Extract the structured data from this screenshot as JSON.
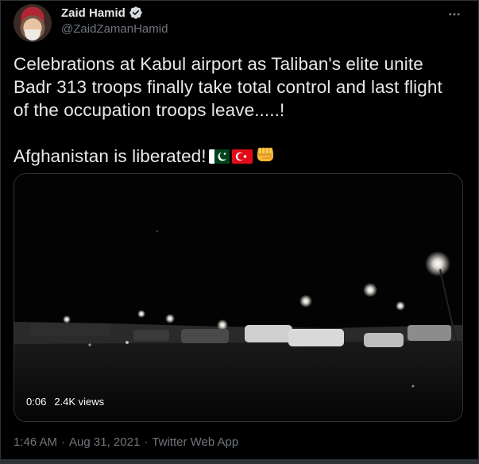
{
  "author": {
    "display_name": "Zaid Hamid",
    "handle": "@ZaidZamanHamid",
    "avatar_icon": "profile-avatar",
    "verified_icon": "verified-badge-icon"
  },
  "tweet": {
    "lines": [
      "Celebrations at Kabul airport as Taliban's elite unite",
      "Badr 313 troops finally take total control and last flight",
      "of the occupation troops leave.....!"
    ],
    "line2": "Afghanistan is liberated!",
    "emojis": [
      "pakistan-flag-icon",
      "turkey-flag-icon",
      "raised-fist-icon"
    ]
  },
  "media": {
    "duration": "0:06",
    "views": "2.4K views",
    "description_icon": "video-thumbnail"
  },
  "footer": {
    "time": "1:46 AM",
    "separator": "·",
    "date": "Aug 31, 2021",
    "source": "Twitter Web App"
  },
  "colors": {
    "background": "#000000",
    "text": "#e7e9ea",
    "secondary": "#71767b",
    "border": "#2f3336",
    "verified": "#829aab"
  }
}
